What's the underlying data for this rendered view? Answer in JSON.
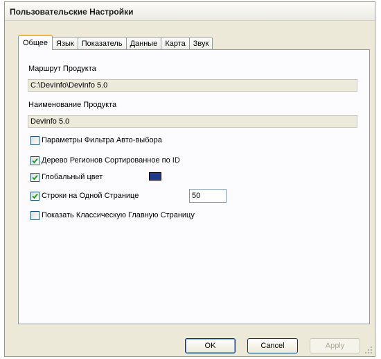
{
  "window": {
    "title": "Пользовательские Настройки"
  },
  "tabs": [
    {
      "label": "Общее",
      "active": true
    },
    {
      "label": "Язык",
      "active": false
    },
    {
      "label": "Показатель",
      "active": false
    },
    {
      "label": "Данные",
      "active": false
    },
    {
      "label": "Карта",
      "active": false
    },
    {
      "label": "Звук",
      "active": false
    }
  ],
  "general": {
    "product_path_label": "Маршрут Продукта",
    "product_path_value": "C:\\DevInfo\\DevInfo 5.0",
    "product_name_label": "Наименование Продукта",
    "product_name_value": "DevInfo 5.0",
    "options": [
      {
        "label": "Параметры Фильтра Авто-выбора",
        "checked": false
      },
      {
        "label": "Дерево Регионов Сортированное по ID",
        "checked": true
      },
      {
        "label": "Глобальный цвет",
        "checked": true
      },
      {
        "label": "Строки на Одной Странице",
        "checked": true
      },
      {
        "label": "Показать Классическую Главную Страницу",
        "checked": false
      }
    ],
    "global_color": "#1f3a8a",
    "rows_per_page": "50"
  },
  "buttons": {
    "ok": "OK",
    "cancel": "Cancel",
    "apply": "Apply"
  },
  "colors": {
    "window_bg": "#ece9d8",
    "panel_bg": "#fcfcfe",
    "tab_accent": "#f3b547",
    "checkmark": "#21a121"
  }
}
